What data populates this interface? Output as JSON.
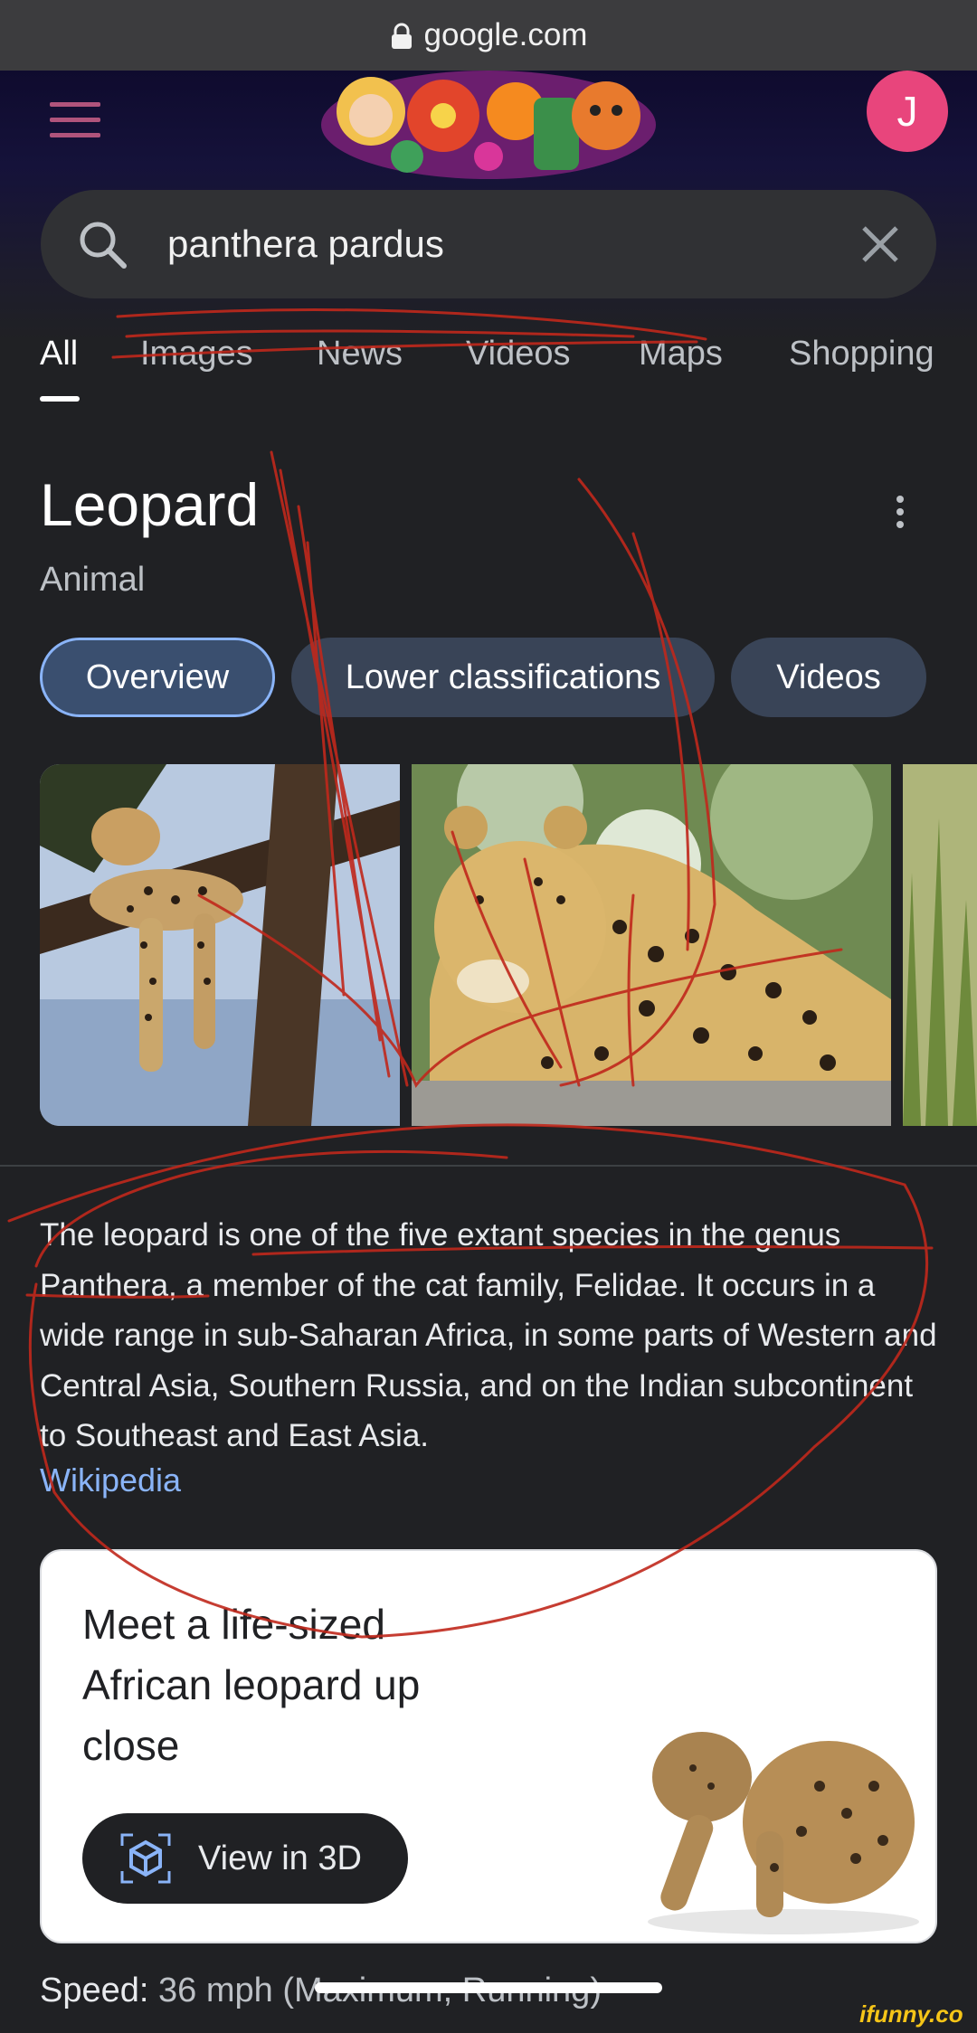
{
  "browser": {
    "url": "google.com"
  },
  "header": {
    "avatar_initial": "J"
  },
  "search": {
    "query": "panthera pardus"
  },
  "tabs": [
    {
      "label": "All"
    },
    {
      "label": "Images"
    },
    {
      "label": "News"
    },
    {
      "label": "Videos"
    },
    {
      "label": "Maps"
    },
    {
      "label": "Shopping"
    }
  ],
  "knowledge_panel": {
    "title": "Leopard",
    "subtitle": "Animal",
    "chips": [
      {
        "label": "Overview"
      },
      {
        "label": "Lower classifications"
      },
      {
        "label": "Videos"
      }
    ],
    "description": "The leopard is one of the five extant species in the genus Panthera, a member of the cat family, Felidae. It occurs in a wide range in sub-Saharan Africa, in some parts of Western and Central Asia, Southern Russia, and on the Indian subcontinent to Southeast and East Asia.",
    "source": "Wikipedia"
  },
  "ar_card": {
    "headline": "Meet a life-sized African leopard up close",
    "button_label": "View in 3D"
  },
  "facts": {
    "speed_label": "Speed:",
    "speed_value": "36 mph (Maximum, Running)"
  },
  "watermark": "ifunny.co",
  "colors": {
    "accent": "#8ab4f8",
    "avatar": "#e8457c",
    "chip_bg": "#394457",
    "scribble": "#c0281c"
  }
}
